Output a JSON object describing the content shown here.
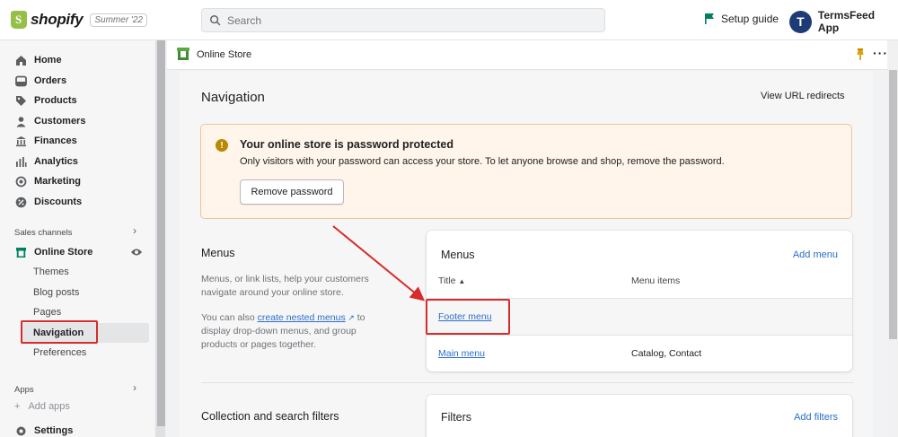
{
  "topbar": {
    "brand": "shopify",
    "edition": "Summer '22",
    "search_placeholder": "Search",
    "setup_guide": "Setup guide",
    "account_initial": "T",
    "account_name": "TermsFeed App"
  },
  "sidebar": {
    "items": [
      {
        "label": "Home",
        "icon": "home-icon"
      },
      {
        "label": "Orders",
        "icon": "orders-icon"
      },
      {
        "label": "Products",
        "icon": "tag-icon"
      },
      {
        "label": "Customers",
        "icon": "person-icon"
      },
      {
        "label": "Finances",
        "icon": "bank-icon"
      },
      {
        "label": "Analytics",
        "icon": "bar-chart-icon"
      },
      {
        "label": "Marketing",
        "icon": "target-icon"
      },
      {
        "label": "Discounts",
        "icon": "discount-icon"
      }
    ],
    "sales_channels_label": "Sales channels",
    "online_store": "Online Store",
    "online_store_sub": [
      "Themes",
      "Blog posts",
      "Pages",
      "Navigation",
      "Preferences"
    ],
    "active_sub": "Navigation",
    "apps_label": "Apps",
    "add_apps": "Add apps",
    "settings": "Settings"
  },
  "appbar": {
    "title": "Online Store"
  },
  "page": {
    "title": "Navigation",
    "view_url_redirects": "View URL redirects"
  },
  "banner": {
    "title": "Your online store is password protected",
    "text": "Only visitors with your password can access your store. To let anyone browse and shop, remove the password.",
    "button": "Remove password"
  },
  "menus_section": {
    "title": "Menus",
    "desc1": "Menus, or link lists, help your customers navigate around your online store.",
    "desc2_pre": "You can also ",
    "desc2_link": "create nested menus",
    "desc2_post": " to display drop-down menus, and group products or pages together."
  },
  "menus_card": {
    "title": "Menus",
    "action": "Add menu",
    "col_title": "Title",
    "col_items": "Menu items",
    "rows": [
      {
        "title": "Footer menu",
        "items": ""
      },
      {
        "title": "Main menu",
        "items": "Catalog, Contact"
      }
    ]
  },
  "filters_section": {
    "title": "Collection and search filters"
  },
  "filters_card": {
    "title": "Filters",
    "action": "Add filters"
  },
  "colors": {
    "accent_link": "#2c6ecb",
    "annotation_red": "#d72c2c",
    "warning_bg": "#fff5ea"
  }
}
